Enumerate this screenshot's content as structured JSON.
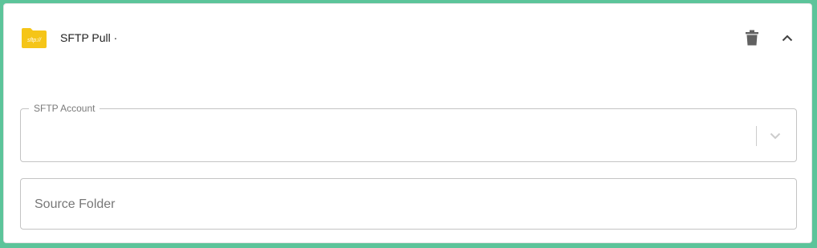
{
  "card": {
    "title": "SFTP Pull ·",
    "icon": "sftp-folder-icon",
    "icon_text": "sftp://",
    "icon_color": "#f5c518",
    "actions": {
      "delete_icon": "trash-icon",
      "collapse_icon": "chevron-up-icon"
    }
  },
  "fields": {
    "sftp_account": {
      "label": "SFTP Account",
      "value": "",
      "dropdown_icon": "chevron-down-icon"
    },
    "source_folder": {
      "placeholder": "Source Folder",
      "value": ""
    }
  },
  "colors": {
    "background": "#5cc49a",
    "card": "#ffffff",
    "icon_folder": "#f5c518",
    "action_icon": "#616161"
  }
}
